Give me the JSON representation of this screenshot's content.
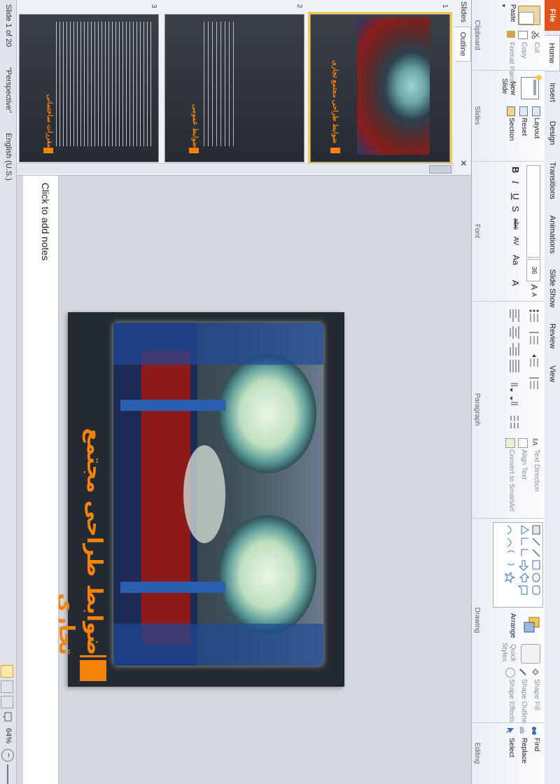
{
  "ribbon_tabs": [
    {
      "label": "File",
      "kind": "file"
    },
    {
      "label": "Home",
      "kind": "active"
    },
    {
      "label": "Insert",
      "kind": "normal"
    },
    {
      "label": "Design",
      "kind": "normal"
    },
    {
      "label": "Transitions",
      "kind": "normal"
    },
    {
      "label": "Animations",
      "kind": "normal"
    },
    {
      "label": "Slide Show",
      "kind": "normal"
    },
    {
      "label": "Review",
      "kind": "normal"
    },
    {
      "label": "View",
      "kind": "normal"
    }
  ],
  "clipboard": {
    "paste": "Paste",
    "cut": "Cut",
    "copy": "Copy",
    "format_painter": "Format Painter",
    "label": "Clipboard"
  },
  "slides_group": {
    "new_slide_line1": "New",
    "new_slide_line2": "Slide",
    "layout": "Layout",
    "reset": "Reset",
    "section": "Section",
    "label": "Slides"
  },
  "font_group": {
    "size": "36",
    "bold": "B",
    "italic": "I",
    "underline": "U",
    "strike": "S",
    "shadow": "abc",
    "spacing": "AV",
    "case": "Aa",
    "color": "A",
    "grow": "A",
    "shrink": "A",
    "label": "Font"
  },
  "paragraph_group": {
    "text_direction": "Text Direction",
    "align_text": "Align Text",
    "convert_smartart": "Convert to SmartArt",
    "label": "Paragraph"
  },
  "drawing_group": {
    "arrange": "Arrange",
    "quick_styles_line1": "Quick",
    "quick_styles_line2": "Styles",
    "shape_fill": "Shape Fill",
    "shape_outline": "Shape Outline",
    "shape_effects": "Shape Effects",
    "label": "Drawing"
  },
  "editing_group": {
    "find": "Find",
    "replace": "Replace",
    "select": "Select",
    "label": "Editing"
  },
  "left_panel": {
    "tab_slides": "Slides",
    "tab_outline": "Outline"
  },
  "thumbnails": [
    {
      "num": "1",
      "title": "ضوابط طراحی مجتمع تجاری"
    },
    {
      "num": "2",
      "title": "ضوابط عمومی"
    },
    {
      "num": "3",
      "title": "مقررات ساختمانی"
    }
  ],
  "slide": {
    "title": "ضوابط طراحی مجتمع تجاری"
  },
  "notes": {
    "placeholder": "Click to add notes"
  },
  "status": {
    "slide_info": "Slide 1 of 20",
    "theme": "\"Perspective\"",
    "language": "English (U.S.)",
    "zoom": "64%"
  },
  "colors": {
    "accent_orange": "#f5820a",
    "slide_bg": "#232a33",
    "file_tab": "#e0521b",
    "selection": "#f5c94a"
  }
}
